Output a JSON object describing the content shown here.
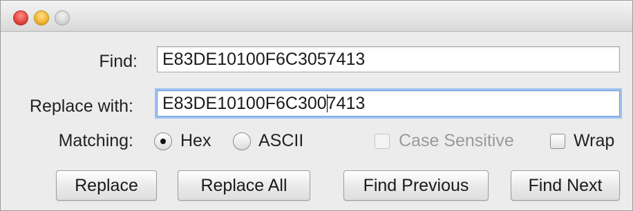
{
  "window": {
    "controls": [
      "close",
      "minimize",
      "zoom"
    ]
  },
  "find": {
    "label": "Find:",
    "value": "E83DE10100F6C3057413"
  },
  "replace": {
    "label": "Replace with:",
    "value_before_caret": "E83DE10100F6C300",
    "value_after_caret": "7413"
  },
  "matching": {
    "label": "Matching:",
    "options": [
      {
        "label": "Hex",
        "selected": true
      },
      {
        "label": "ASCII",
        "selected": false
      }
    ],
    "case_sensitive": {
      "label": "Case Sensitive",
      "checked": false,
      "enabled": false
    },
    "wrap": {
      "label": "Wrap",
      "checked": false,
      "enabled": true
    }
  },
  "buttons": {
    "replace": "Replace",
    "replace_all": "Replace All",
    "find_previous": "Find Previous",
    "find_next": "Find Next"
  },
  "colors": {
    "focus_ring": "#9ec2f0",
    "close": "#e0443e",
    "minimize": "#f0b32e"
  }
}
